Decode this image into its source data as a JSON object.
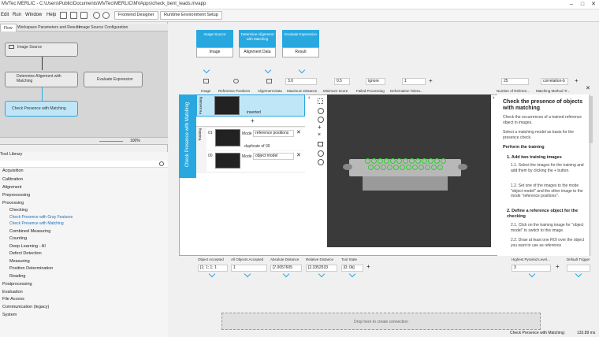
{
  "titlebar": {
    "title": "MVTec MERLIC - C:\\Users\\Public\\Documents\\MVTec\\MERLIC\\MVApps\\check_bent_leads.mvapp",
    "min": "–",
    "max": "□",
    "close": "✕"
  },
  "menu": {
    "items": [
      "Edit",
      "Run",
      "Window",
      "Help"
    ],
    "frontend": "Frontend Designer",
    "runtime": "Runtime Environment Setup"
  },
  "left_tabs": [
    "Flow",
    "Workspace Parameters and Results",
    "Image Source Configuration"
  ],
  "flow_nodes": {
    "image_source": "Image Source",
    "determine_alignment": "Determine Alignment with Matching",
    "evaluate_expression": "Evaluate Expression",
    "check_presence": "Check Presence with Matching"
  },
  "zoom": "100%",
  "library": {
    "title": "Tool Library",
    "items": [
      "Acquisition",
      "Calibration",
      "Alignment",
      "Preprocessing",
      "Processing",
      "Checking",
      "Combined Measuring",
      "Counting",
      "Deep Learning - AI",
      "Defect Detection",
      "Measuring",
      "Position Determination",
      "Reading",
      "Postprocessing",
      "Evaluation",
      "File Access",
      "Communication (legacy)",
      "System"
    ],
    "sub_items": [
      "Check Presence with Gray Features",
      "Check Presence with Matching"
    ]
  },
  "inputs": [
    {
      "label": "Image Source",
      "value": "Image"
    },
    {
      "label": "Determine Alignment with Matching",
      "value": "Alignment Data"
    },
    {
      "label": "Evaluate Expression",
      "value": "Result"
    }
  ],
  "params": {
    "max_distance": "3.0",
    "min_score": "0.5",
    "failed_processing": "ignore",
    "deformation": "1",
    "num_ref": "25",
    "method": "correlation-b"
  },
  "param_labels": [
    "Image",
    "Reference Positions",
    "Alignment Data",
    "Maximum Distance",
    "Minimum Score",
    "Failed Processing",
    "Deformation Tolera...",
    "Number of Referen...",
    "Matching Method Tr..."
  ],
  "tool": {
    "title": "Check Presence with Matching",
    "processing": "Processing",
    "training": "Training",
    "inserted": "inserted",
    "duplicate": "duplicate of 00",
    "row01_id": "01",
    "row00_id": "00",
    "mode_label": "Mode",
    "mode01": "reference positions",
    "mode00": "object model"
  },
  "help": {
    "title": "Check the presence of objects with matching",
    "p1": "Check the occurrences of a trained reference object in images.",
    "p2": "Select a matching model as basis for the presence check.",
    "h_training": "Perform the training",
    "h_step1": "1. Add two training images",
    "s11": "1.1. Select the images for the training and add them by clicking the + button.",
    "s12": "1.2. Set one of the images to the mode \"object model\" and the other image to the mode \"reference positions\".",
    "h_step2": "2. Define a reference object for the checking",
    "s21": "2.1. Click on the training image for \"object model\" to switch to this image.",
    "s22": "2.2. Draw at least one ROI over the object you want to use as reference"
  },
  "outputs": {
    "labels": [
      "Object Accepted",
      "All Objects Accepted",
      "Absolute Distance",
      "Relative Distance",
      "Tool State",
      "Highest Pyramid Level...",
      "Default Trigger"
    ],
    "values": [
      "[1; 1; 1; 1",
      "1",
      "[7.0057605",
      "[2.3352533",
      "[0; 0k]",
      "3",
      ""
    ]
  },
  "drop_text": "Drop here to create connection",
  "status": {
    "text": "Check Presence with Matching:",
    "time": "133.89 ms"
  }
}
